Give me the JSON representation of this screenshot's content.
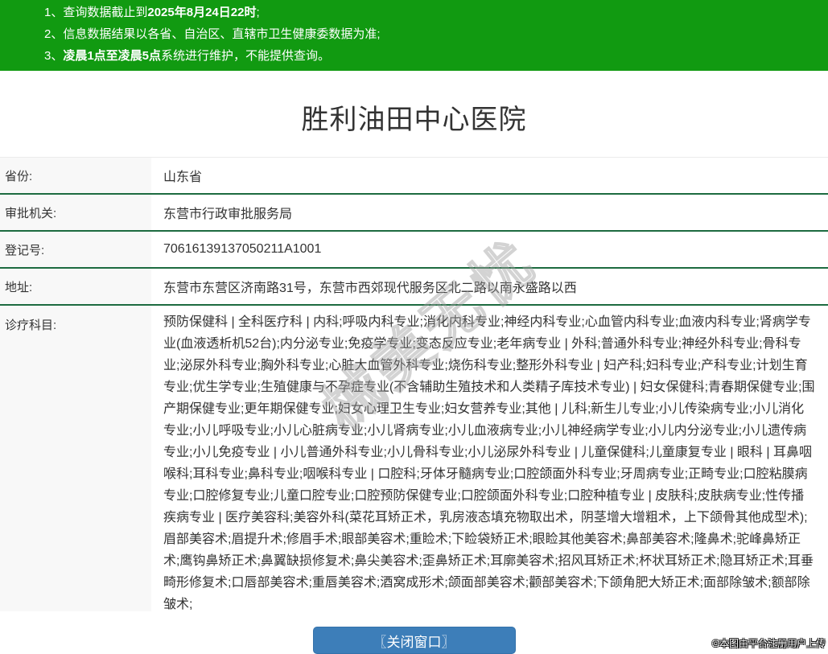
{
  "banner": {
    "bg_color": "#119a11",
    "notices": [
      {
        "num": "1、",
        "pre": "查询数据截止到",
        "bold": "2025年8月24日22时",
        "post": ";"
      },
      {
        "num": "2、",
        "pre": "信息数据结果以各省、自治区、直辖市卫生健康委数据为准;",
        "bold": "",
        "post": ""
      },
      {
        "num": "3、",
        "pre": "",
        "bold": "凌晨1点至凌晨5点",
        "post": "系统进行维护，不能提供查询。"
      }
    ]
  },
  "title": "胜利油田中心医院",
  "fields": [
    {
      "label": "省份:",
      "value": "山东省"
    },
    {
      "label": "审批机关:",
      "value": "东营市行政审批服务局"
    },
    {
      "label": "登记号:",
      "value": "70616139137050211A1001"
    },
    {
      "label": "地址:",
      "value": "东营市东营区济南路31号，东营市西郊现代服务区北二路以南永盛路以西"
    },
    {
      "label": "诊疗科目:",
      "value": "预防保健科 | 全科医疗科 | 内科;呼吸内科专业;消化内科专业;神经内科专业;心血管内科专业;血液内科专业;肾病学专业(血液透析机52台);内分泌专业;免疫学专业;变态反应专业;老年病专业 | 外科;普通外科专业;神经外科专业;骨科专业;泌尿外科专业;胸外科专业;心脏大血管外科专业;烧伤科专业;整形外科专业 | 妇产科;妇科专业;产科专业;计划生育专业;优生学专业;生殖健康与不孕症专业(不含辅助生殖技术和人类精子库技术专业) | 妇女保健科;青春期保健专业;围产期保健专业;更年期保健专业;妇女心理卫生专业;妇女营养专业;其他 | 儿科;新生儿专业;小儿传染病专业;小儿消化专业;小儿呼吸专业;小儿心脏病专业;小儿肾病专业;小儿血液病专业;小儿神经病学专业;小儿内分泌专业;小儿遗传病专业;小儿免疫专业 | 小儿普通外科专业;小儿骨科专业;小儿泌尿外科专业 | 儿童保健科;儿童康复专业 | 眼科 | 耳鼻咽喉科;耳科专业;鼻科专业;咽喉科专业 | 口腔科;牙体牙髓病专业;口腔颌面外科专业;牙周病专业;正畸专业;口腔粘膜病专业;口腔修复专业;儿童口腔专业;口腔预防保健专业;口腔颌面外科专业;口腔种植专业 | 皮肤科;皮肤病专业;性传播疾病专业 | 医疗美容科;美容外科(菜花耳矫正术，乳房液态填充物取出术，阴茎增大增粗术，上下颌骨其他成型术);眉部美容术;眉提升术;修眉手术;眼部美容术;重睑术;下睑袋矫正术;眼睑其他美容术;鼻部美容术;隆鼻术;驼峰鼻矫正术;鹰钩鼻矫正术;鼻翼缺损修复术;鼻尖美容术;歪鼻矫正术;耳廓美容术;招风耳矫正术;杯状耳矫正术;隐耳矫正术;耳垂畸形修复术;口唇部美容术;重唇美容术;酒窝成形术;颌面部美容术;颧部美容术;下颌角肥大矫正术;面部除皱术;额部除皱术;"
    }
  ],
  "watermark": "械美无忧",
  "close_button_label": "〖关闭窗口〗",
  "footer_note": "©本图由平台注册用户上传",
  "colors": {
    "banner_green": "#119a11",
    "separator_green": "#1d6b40",
    "label_bg_gray": "#f8f8f8",
    "button_blue": "#3d7eb9",
    "text_dark": "#333333"
  }
}
